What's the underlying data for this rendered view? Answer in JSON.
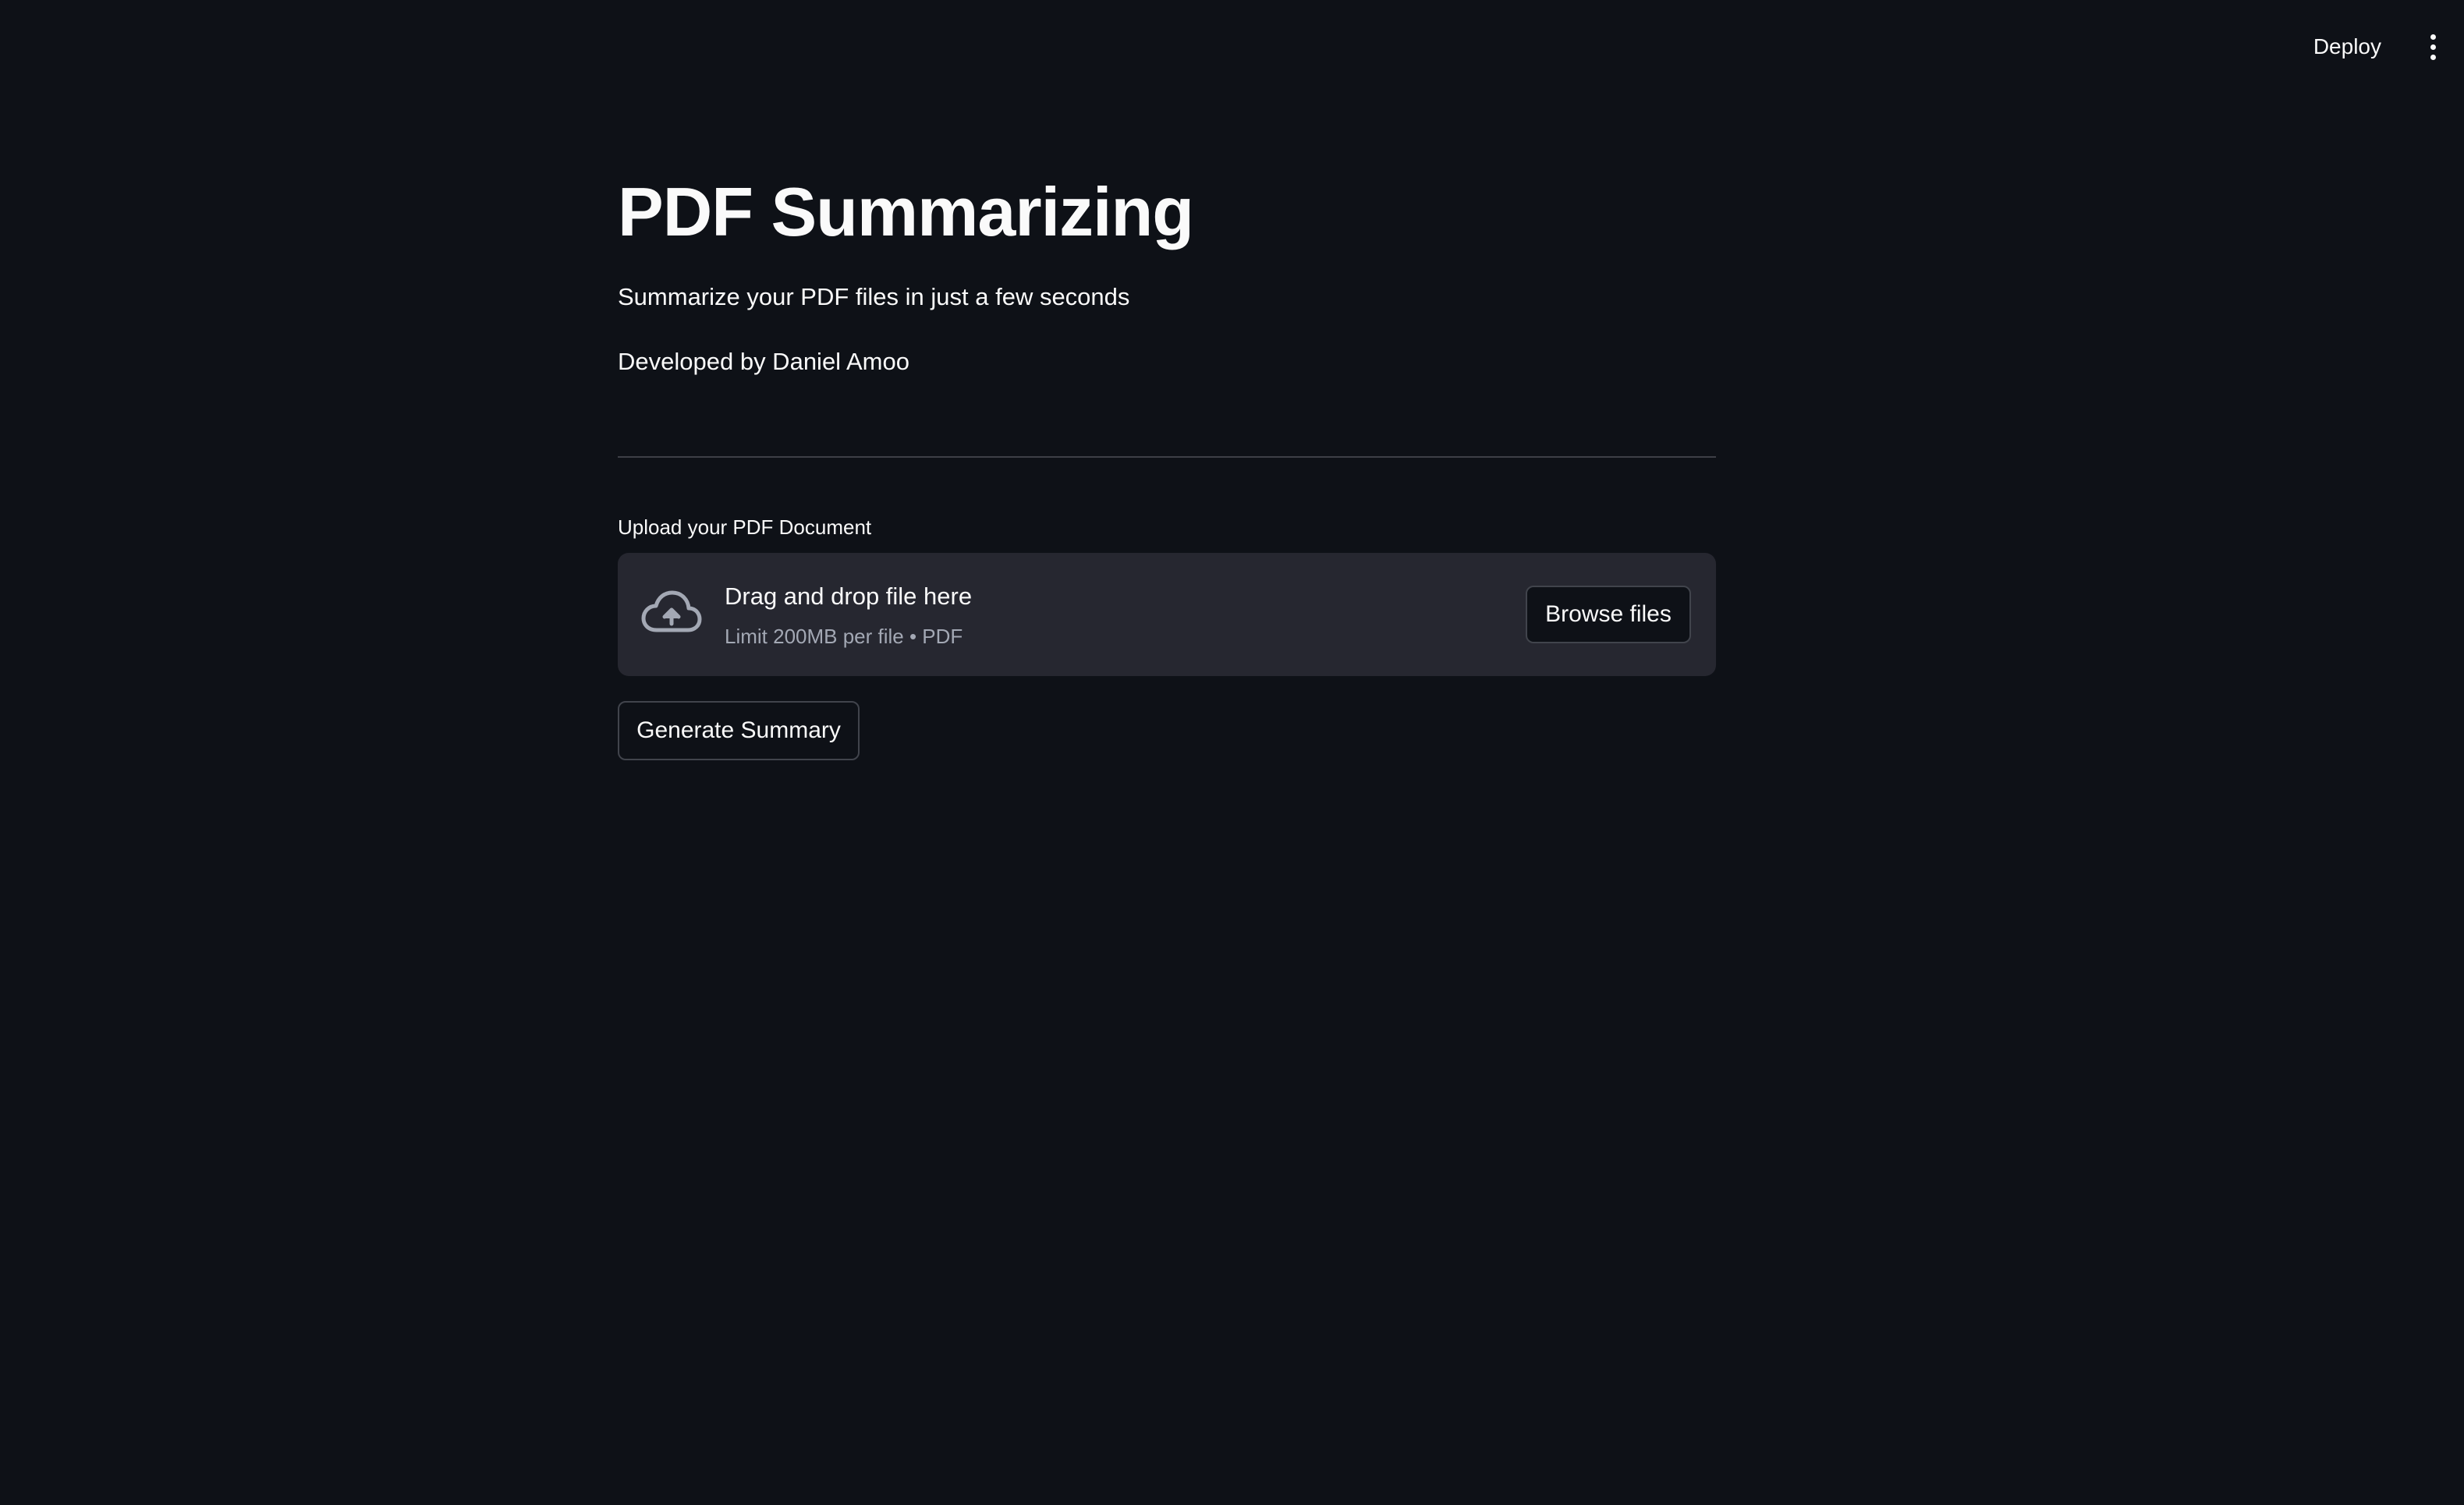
{
  "header": {
    "deploy_label": "Deploy",
    "menu_icon": "more-vertical-icon"
  },
  "main": {
    "title": "PDF Summarizing",
    "subtitle": "Summarize your PDF files in just a few seconds",
    "author": "Developed by Daniel Amoo"
  },
  "uploader": {
    "label": "Upload your PDF Document",
    "icon": "cloud-upload-icon",
    "drop_text": "Drag and drop file here",
    "limit_text": "Limit 200MB per file • PDF",
    "browse_label": "Browse files"
  },
  "actions": {
    "generate_label": "Generate Summary"
  },
  "colors": {
    "background": "#0e1117",
    "dropzone": "#262730",
    "text": "#fafafa",
    "muted_text": "#a3a8b4",
    "border": "#41444c"
  }
}
